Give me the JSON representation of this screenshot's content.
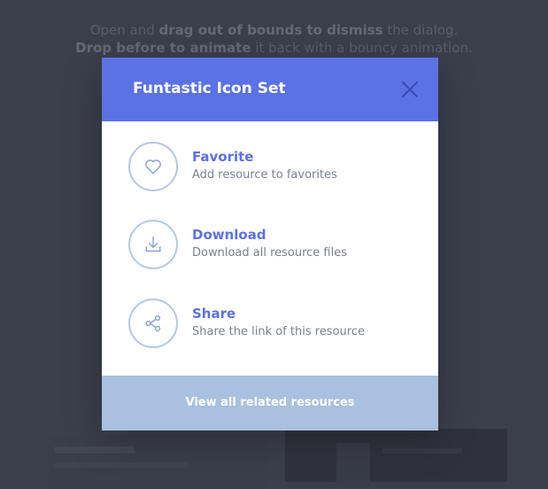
{
  "background": {
    "line1": {
      "before": "Open and",
      "bold": "drag out of bounds to dismiss",
      "after": "the dialog."
    },
    "line2": {
      "bold": "Drop before to animate",
      "after": "it back with a bouncy animation."
    }
  },
  "dialog": {
    "title": "Funtastic Icon Set",
    "close_icon": "close-icon",
    "items": [
      {
        "icon": "heart-icon",
        "title": "Favorite",
        "description": "Add resource to favorites"
      },
      {
        "icon": "download-icon",
        "title": "Download",
        "description": "Download all resource files"
      },
      {
        "icon": "share-icon",
        "title": "Share",
        "description": "Share the link of this resource"
      }
    ],
    "footer_label": "View all related resources"
  },
  "colors": {
    "page_background": "#3b3f4b",
    "header": "#5a72e4",
    "accent_text": "#5a72e4",
    "icon_stroke": "#b6c8e3",
    "footer": "#a9c0de",
    "description_text": "#7a808e"
  }
}
